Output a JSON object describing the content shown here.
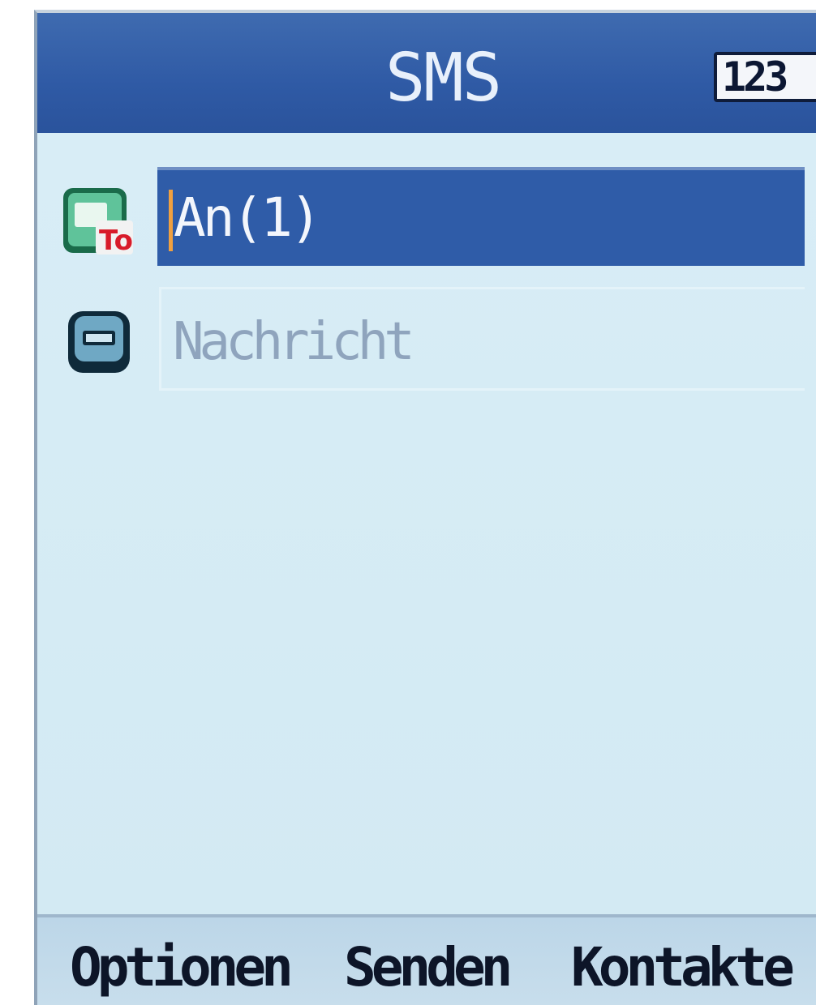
{
  "header": {
    "title": "SMS",
    "input_mode": "123"
  },
  "fields": {
    "recipient": {
      "label": "An(1)",
      "icon": "to-recipient-icon"
    },
    "message": {
      "placeholder": "Nachricht",
      "icon": "message-icon"
    }
  },
  "softkeys": {
    "left": "Optionen",
    "center": "Senden",
    "right": "Kontakte"
  },
  "colors": {
    "title_bar": "#2f5aa5",
    "selection": "#2f5ca8",
    "background": "#d4ebf4",
    "softkey_bar": "#c8deec",
    "placeholder_text": "#8fa4bd",
    "cursor": "#f0a040"
  }
}
